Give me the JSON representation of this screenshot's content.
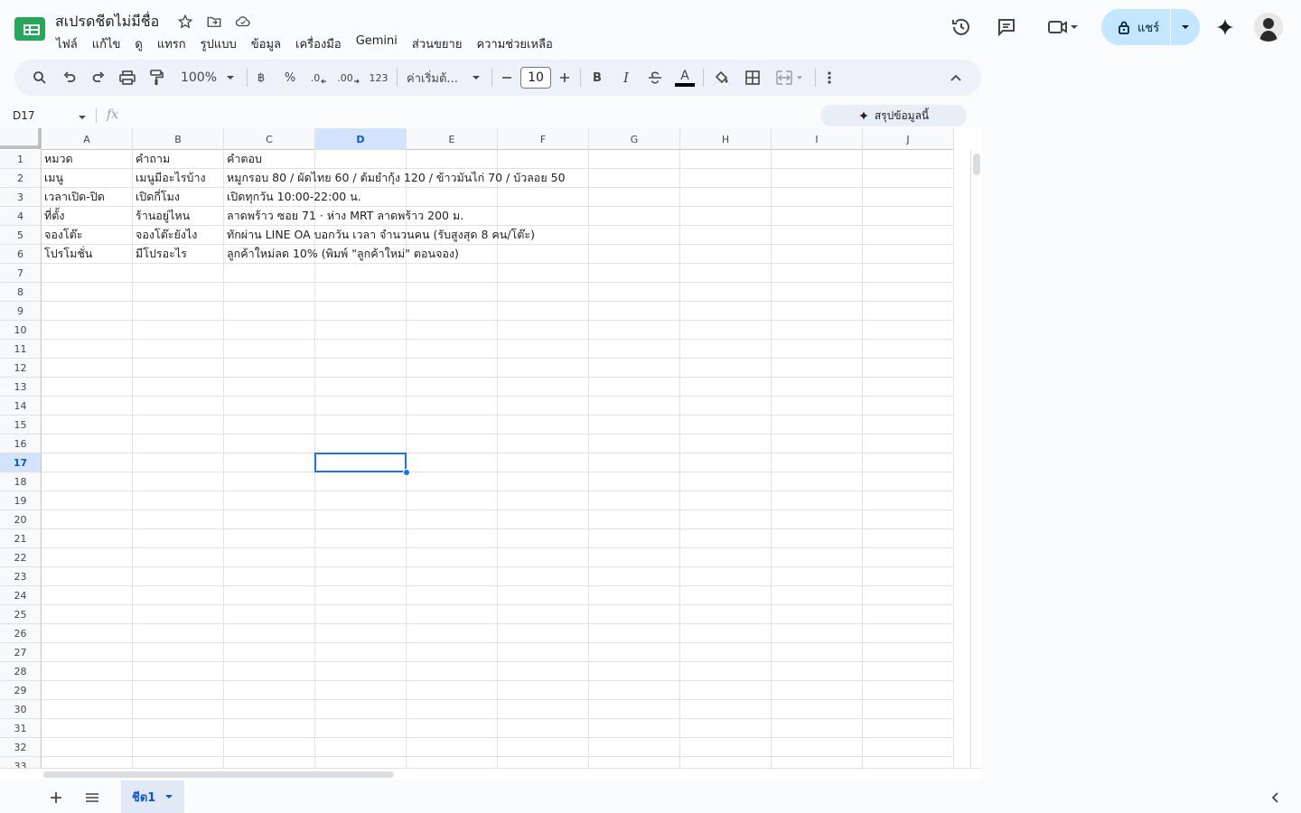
{
  "doc": {
    "title": "สเปรดชีตไม่มีชื่อ"
  },
  "menu": [
    "ไฟล์",
    "แก้ไข",
    "ดู",
    "แทรก",
    "รูปแบบ",
    "ข้อมูล",
    "เครื่องมือ",
    "Gemini",
    "ส่วนขยาย",
    "ความช่วยเหลือ"
  ],
  "share": {
    "label": "แชร์"
  },
  "toolbar": {
    "zoom": "100%",
    "currency": "฿",
    "percent": "%",
    "dec_decrease": ".0",
    "dec_increase": ".00",
    "format_number": "123",
    "font": "ค่าเริ่มต้...",
    "font_size": "10",
    "bold": "B",
    "italic": "I",
    "text_color": "A"
  },
  "formula": {
    "name_box": "D17",
    "fx": "fx",
    "summarize_label": "สรุปข้อมูลนี้"
  },
  "grid": {
    "columns": [
      "A",
      "B",
      "C",
      "D",
      "E",
      "F",
      "G",
      "H",
      "I",
      "J"
    ],
    "selected_column": "D",
    "selected_row": 17,
    "row_count": 33,
    "rows": [
      [
        "หมวด",
        "คำถาม",
        "คำตอบ"
      ],
      [
        "เมนู",
        "เมนูมีอะไรบ้าง",
        "หมูกรอบ 80 / ผัดไทย 60 / ต้มยำกุ้ง 120 / ข้าวมันไก่ 70 / บัวลอย 50"
      ],
      [
        "เวลาเปิด-ปิด",
        "เปิดกี่โมง",
        "เปิดทุกวัน 10:00-22:00 น."
      ],
      [
        "ที่ตั้ง",
        "ร้านอยู่ไหน",
        "ลาดพร้าว ซอย 71 · ห่าง MRT ลาดพร้าว 200 ม."
      ],
      [
        "จองโต๊ะ",
        "จองโต๊ะยังไง",
        "ทักผ่าน LINE OA บอกวัน เวลา จำนวนคน (รับสูงสุด 8 คน/โต๊ะ)"
      ],
      [
        "โปรโมชั่น",
        "มีโปรอะไร",
        "ลูกค้าใหม่ลด 10% (พิมพ์ \"ลูกค้าใหม่\" ตอนจอง)"
      ]
    ]
  },
  "sheets": [
    {
      "name": "ชีต1",
      "active": true
    }
  ],
  "colors": {
    "accent": "#0b57d0",
    "share_bg": "#c2e7ff",
    "selection": "#1a73e8",
    "toolbar_bg": "#edf2fa"
  }
}
